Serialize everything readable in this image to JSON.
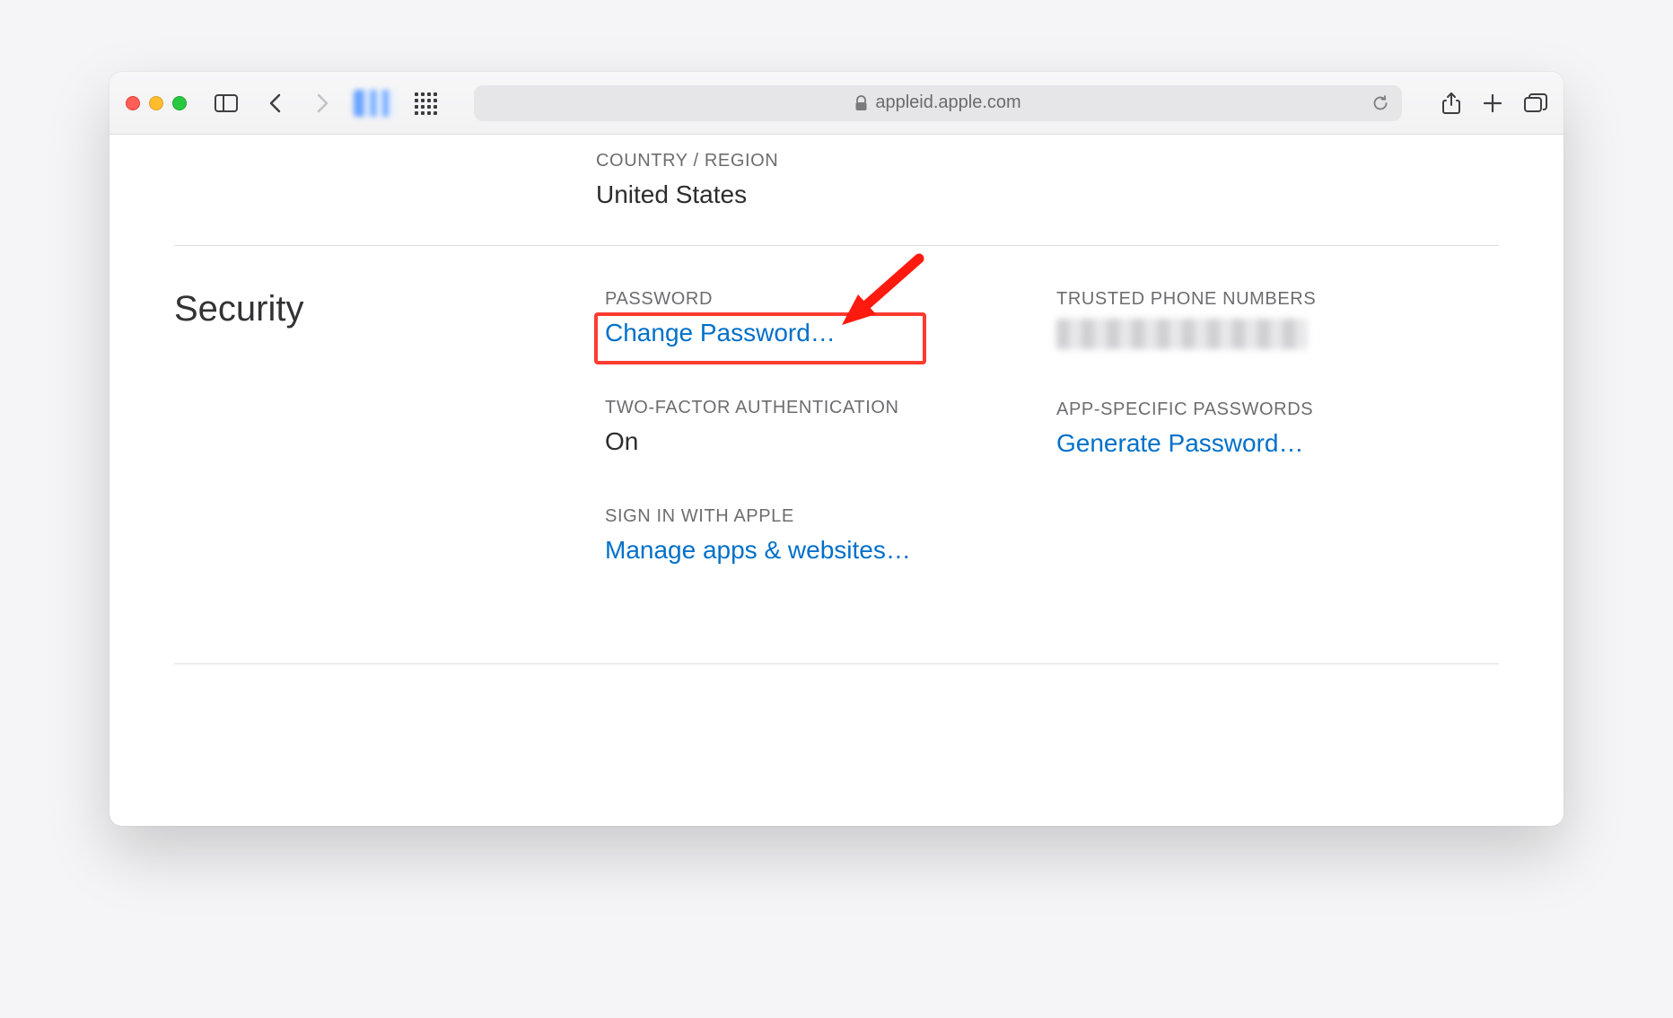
{
  "toolbar": {
    "url": "appleid.apple.com"
  },
  "top": {
    "country_region_label": "COUNTRY / REGION",
    "country_region_value": "United States"
  },
  "security": {
    "title": "Security",
    "password": {
      "label": "PASSWORD",
      "link": "Change Password…"
    },
    "two_factor": {
      "label": "TWO-FACTOR AUTHENTICATION",
      "value": "On"
    },
    "sign_in_apple": {
      "label": "SIGN IN WITH APPLE",
      "link": "Manage apps & websites…"
    },
    "trusted_phones": {
      "label": "TRUSTED PHONE NUMBERS"
    },
    "app_specific": {
      "label": "APP-SPECIFIC PASSWORDS",
      "link": "Generate Password…"
    }
  }
}
